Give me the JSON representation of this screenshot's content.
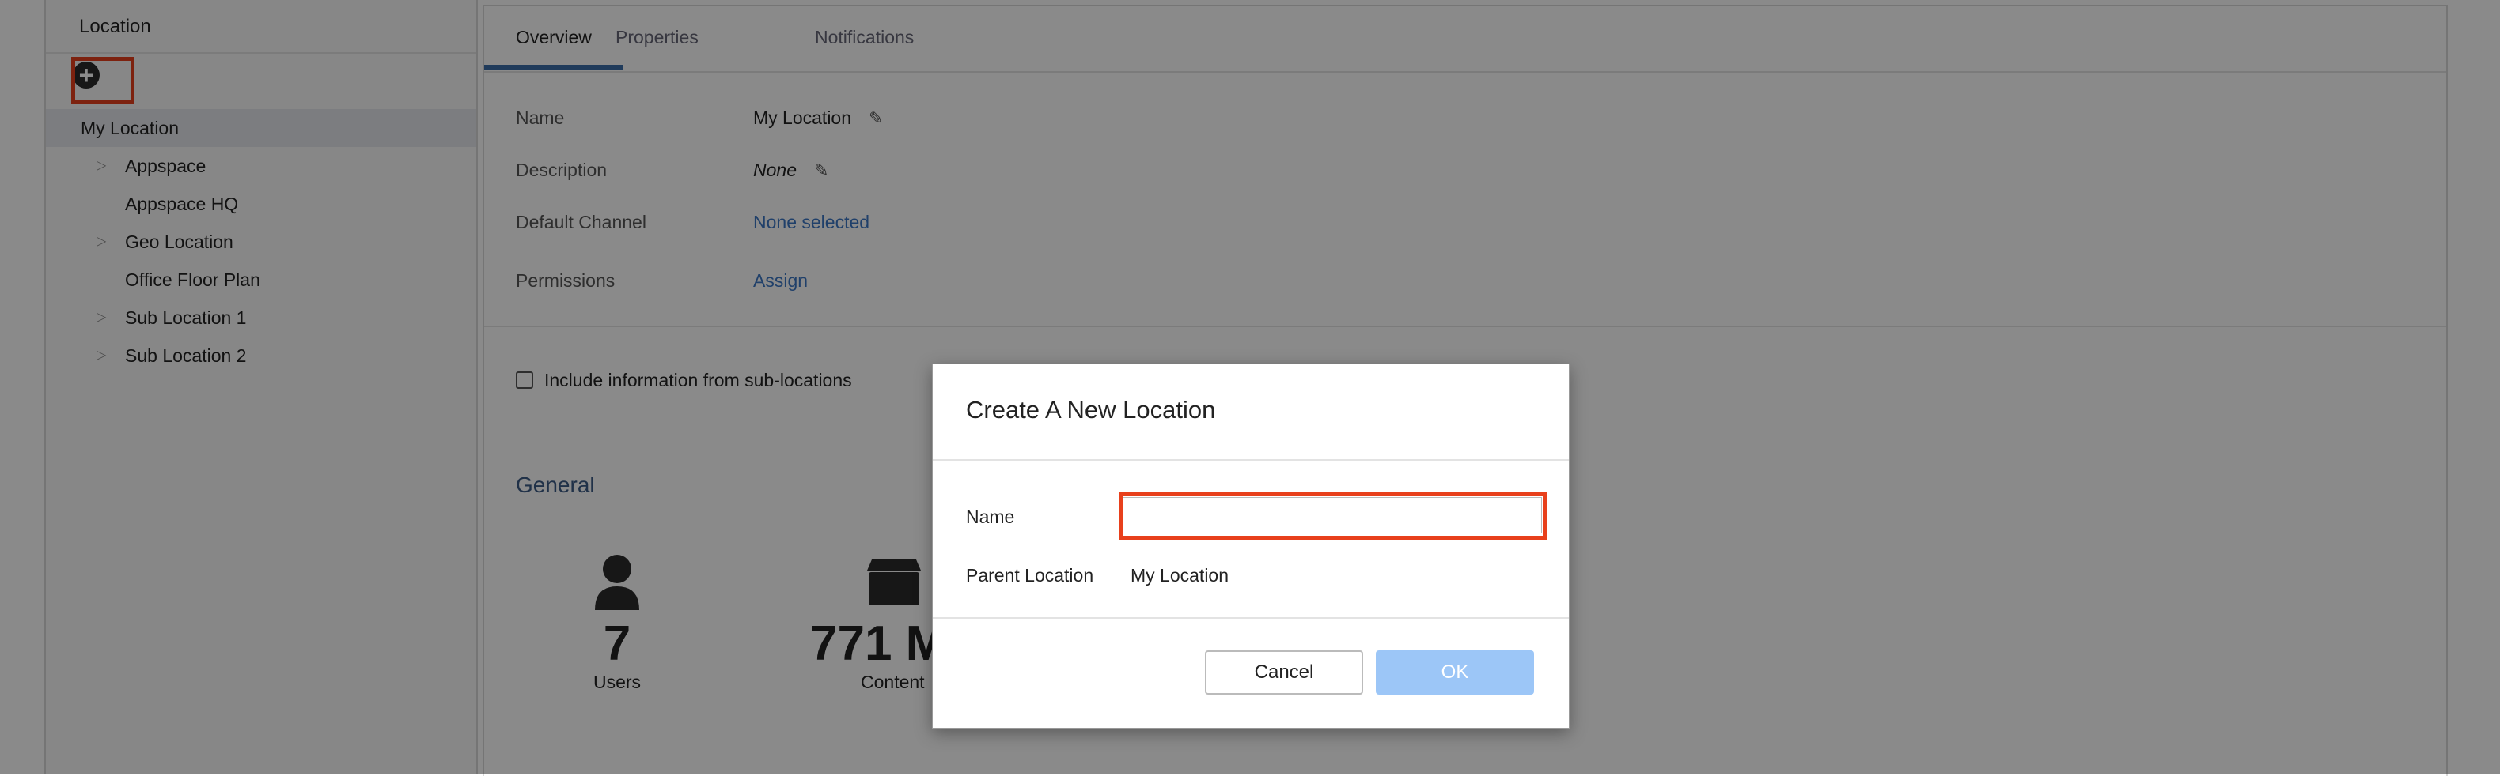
{
  "left_panel": {
    "title": "Location",
    "root_item": "My Location",
    "items": [
      {
        "label": "Appspace",
        "expandable": true
      },
      {
        "label": "Appspace HQ",
        "expandable": false
      },
      {
        "label": "Geo Location",
        "expandable": true
      },
      {
        "label": "Office Floor Plan",
        "expandable": false
      },
      {
        "label": "Sub Location 1",
        "expandable": true
      },
      {
        "label": "Sub Location 2",
        "expandable": true
      }
    ],
    "add_icon": "plus-circle-icon"
  },
  "tabs": [
    "Overview",
    "Properties",
    "Notifications"
  ],
  "active_tab": "Overview",
  "details": {
    "name_label": "Name",
    "name_value": "My Location",
    "description_label": "Description",
    "description_value": "None",
    "default_channel_label": "Default Channel",
    "default_channel_value": "None selected",
    "permissions_label": "Permissions",
    "permissions_value": "Assign"
  },
  "include_sublocations_label": "Include information from sub-locations",
  "general": {
    "title": "General",
    "users_value": "7",
    "users_caption": "Users",
    "content_value": "771 M",
    "content_caption": "Content"
  },
  "modal": {
    "title": "Create A New Location",
    "name_label": "Name",
    "name_value": "",
    "parent_label": "Parent Location",
    "parent_value": "My Location",
    "cancel_label": "Cancel",
    "ok_label": "OK"
  },
  "colors": {
    "highlight": "#e8401c",
    "link": "#3b76c4",
    "ok_button": "#9cc6f7",
    "tab_underline": "#3b6ea8"
  }
}
